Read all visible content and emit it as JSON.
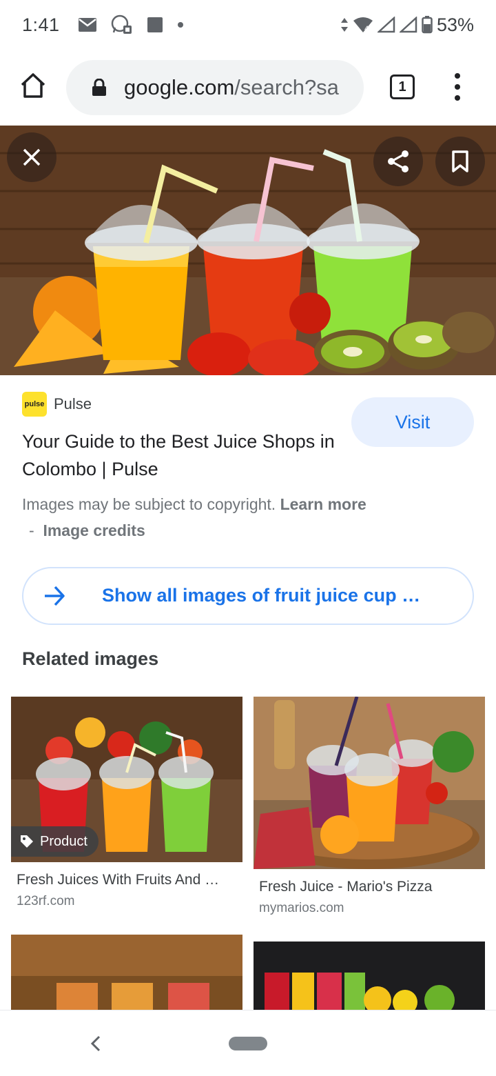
{
  "status_bar": {
    "time": "1:41",
    "battery": "53%",
    "network_label": "4",
    "icons": [
      "gmail-icon",
      "whatsapp-icon",
      "square-icon",
      "dot-icon",
      "data-arrows-icon",
      "wifi-icon",
      "signal-icon",
      "signal-icon",
      "battery-icon"
    ]
  },
  "browser": {
    "url_domain": "google.com",
    "url_path": "/search?sa",
    "tab_count": "1"
  },
  "result": {
    "source_name": "Pulse",
    "source_logo_text": "pulse",
    "visit_label": "Visit",
    "title": "Your Guide to the Best Juice Shops in Colombo | Pulse",
    "copyright_text": "Images may be subject to copyright.",
    "learn_more": "Learn more",
    "credits_prefix": "-",
    "image_credits": "Image credits",
    "show_all": "Show all images of fruit juice cup …"
  },
  "related": {
    "heading": "Related images",
    "items": [
      {
        "title": "Fresh Juices With Fruits And …",
        "domain": "123rf.com",
        "badge": "Product"
      },
      {
        "title": "Fresh Juice - Mario's Pizza",
        "domain": "mymarios.com"
      }
    ]
  },
  "colors": {
    "accent": "#1a73e8",
    "visit_bg": "#e8f0fe",
    "omnibox_bg": "#f1f3f4"
  }
}
